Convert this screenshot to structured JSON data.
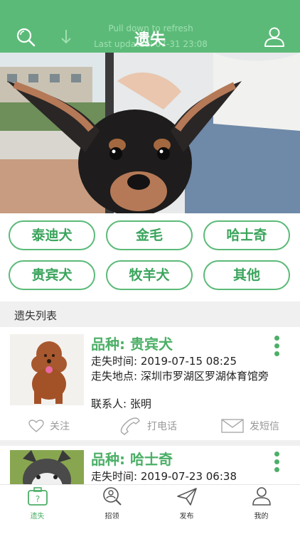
{
  "header": {
    "title": "遗失",
    "pull_hint": "Pull down to refresh",
    "last_updated": "Last updated: 07-31 23:08"
  },
  "breeds": [
    "泰迪犬",
    "金毛",
    "哈士奇",
    "贵宾犬",
    "牧羊犬",
    "其他"
  ],
  "section_title": "遗失列表",
  "cards": [
    {
      "breed": "品种: 贵宾犬",
      "lost_time": "走失时间: 2019-07-15 08:25",
      "lost_place": "走失地点: 深圳市罗湖区罗湖体育馆旁",
      "contact": "联系人: 张明",
      "actions": {
        "follow": "关注",
        "call": "打电话",
        "sms": "发短信"
      }
    },
    {
      "breed": "品种: 哈士奇",
      "lost_time": "走失时间: 2019-07-23 06:38"
    }
  ],
  "nav": [
    {
      "label": "遗失",
      "icon": "lost-pet-icon",
      "active": true
    },
    {
      "label": "招领",
      "icon": "find-icon",
      "active": false
    },
    {
      "label": "发布",
      "icon": "send-icon",
      "active": false
    },
    {
      "label": "我的",
      "icon": "user-icon",
      "active": false
    }
  ],
  "colors": {
    "brand": "#5cba78",
    "accent_text": "#4caf67",
    "gray_text": "#999999",
    "section_bg": "#f0f0f0"
  }
}
